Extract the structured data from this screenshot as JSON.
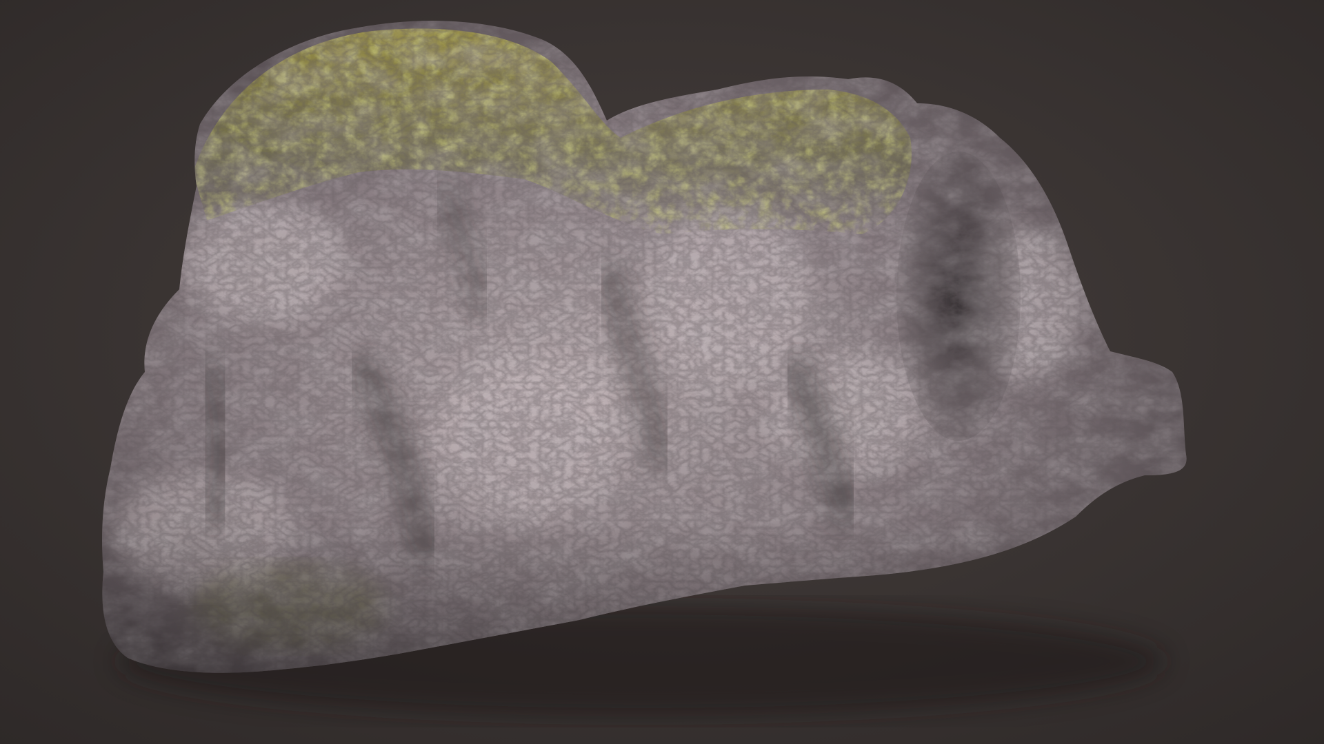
{
  "scene": {
    "subject_icon": "rock-icon",
    "colors": {
      "background_center": "#463f3d",
      "background_edge": "#2e2928",
      "rock_light": "#c2b5b8",
      "rock_mid": "#8c8085",
      "rock_dark": "#4a4246",
      "rock_shadow": "#2b2628",
      "moss_light": "#b1a83e",
      "moss_mid": "#77773a",
      "moss_dark": "#4c5230"
    }
  }
}
